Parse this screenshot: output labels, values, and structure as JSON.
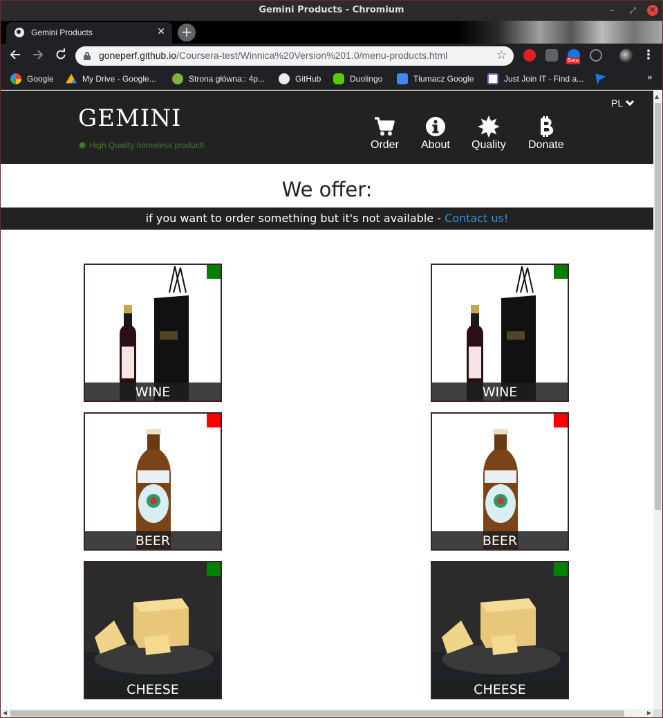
{
  "window": {
    "title": "Gemini Products - Chromium"
  },
  "tab": {
    "title": "Gemini Products",
    "close": "✕",
    "new_tab": "+"
  },
  "address_bar": {
    "host": "goneperf.github.io",
    "path": "/Coursera-test/Winnica%20Version%201.0/menu-products.html"
  },
  "extensions": {
    "badge": "Beta"
  },
  "bookmarks": [
    {
      "label": "Google",
      "icon": "google-icon",
      "color": "#ea4335"
    },
    {
      "label": "My Drive - Google...",
      "icon": "drive-icon",
      "color": "#f4b400"
    },
    {
      "label": "Strona główna:: 4p...",
      "icon": "leaf-icon",
      "color": "#7cb342"
    },
    {
      "label": "GitHub",
      "icon": "github-icon",
      "color": "#e8eaed"
    },
    {
      "label": "Duolingo",
      "icon": "duolingo-icon",
      "color": "#58cc02"
    },
    {
      "label": "Tłumacz Google",
      "icon": "translate-icon",
      "color": "#4285f4"
    },
    {
      "label": "Just Join IT - Find a...",
      "icon": "justjoin-icon",
      "color": "#8e63ce"
    },
    {
      "label": "",
      "icon": "flag-icon",
      "color": "#1a73e8"
    }
  ],
  "site": {
    "brand": "GEMINI",
    "tagline": "High Quality homeless product!",
    "language": "PL",
    "nav": [
      {
        "label": "Order",
        "icon": "cart-icon"
      },
      {
        "label": "About",
        "icon": "info-icon"
      },
      {
        "label": "Quality",
        "icon": "burst-icon"
      },
      {
        "label": "Donate",
        "icon": "bitcoin-icon"
      }
    ],
    "heading": "We offer:",
    "banner_text": "if you want to order something but it's not available - ",
    "banner_link": "Contact us!"
  },
  "colors": {
    "available": "#008000",
    "unavailable": "#ff0000",
    "header_bg": "#222222",
    "accent_link": "#3a8fd9"
  },
  "products": [
    {
      "name": "WINE",
      "available": true
    },
    {
      "name": "WINE",
      "available": true
    },
    {
      "name": "BEER",
      "available": false
    },
    {
      "name": "BEER",
      "available": false
    },
    {
      "name": "CHEESE",
      "available": true
    },
    {
      "name": "CHEESE",
      "available": true
    }
  ]
}
